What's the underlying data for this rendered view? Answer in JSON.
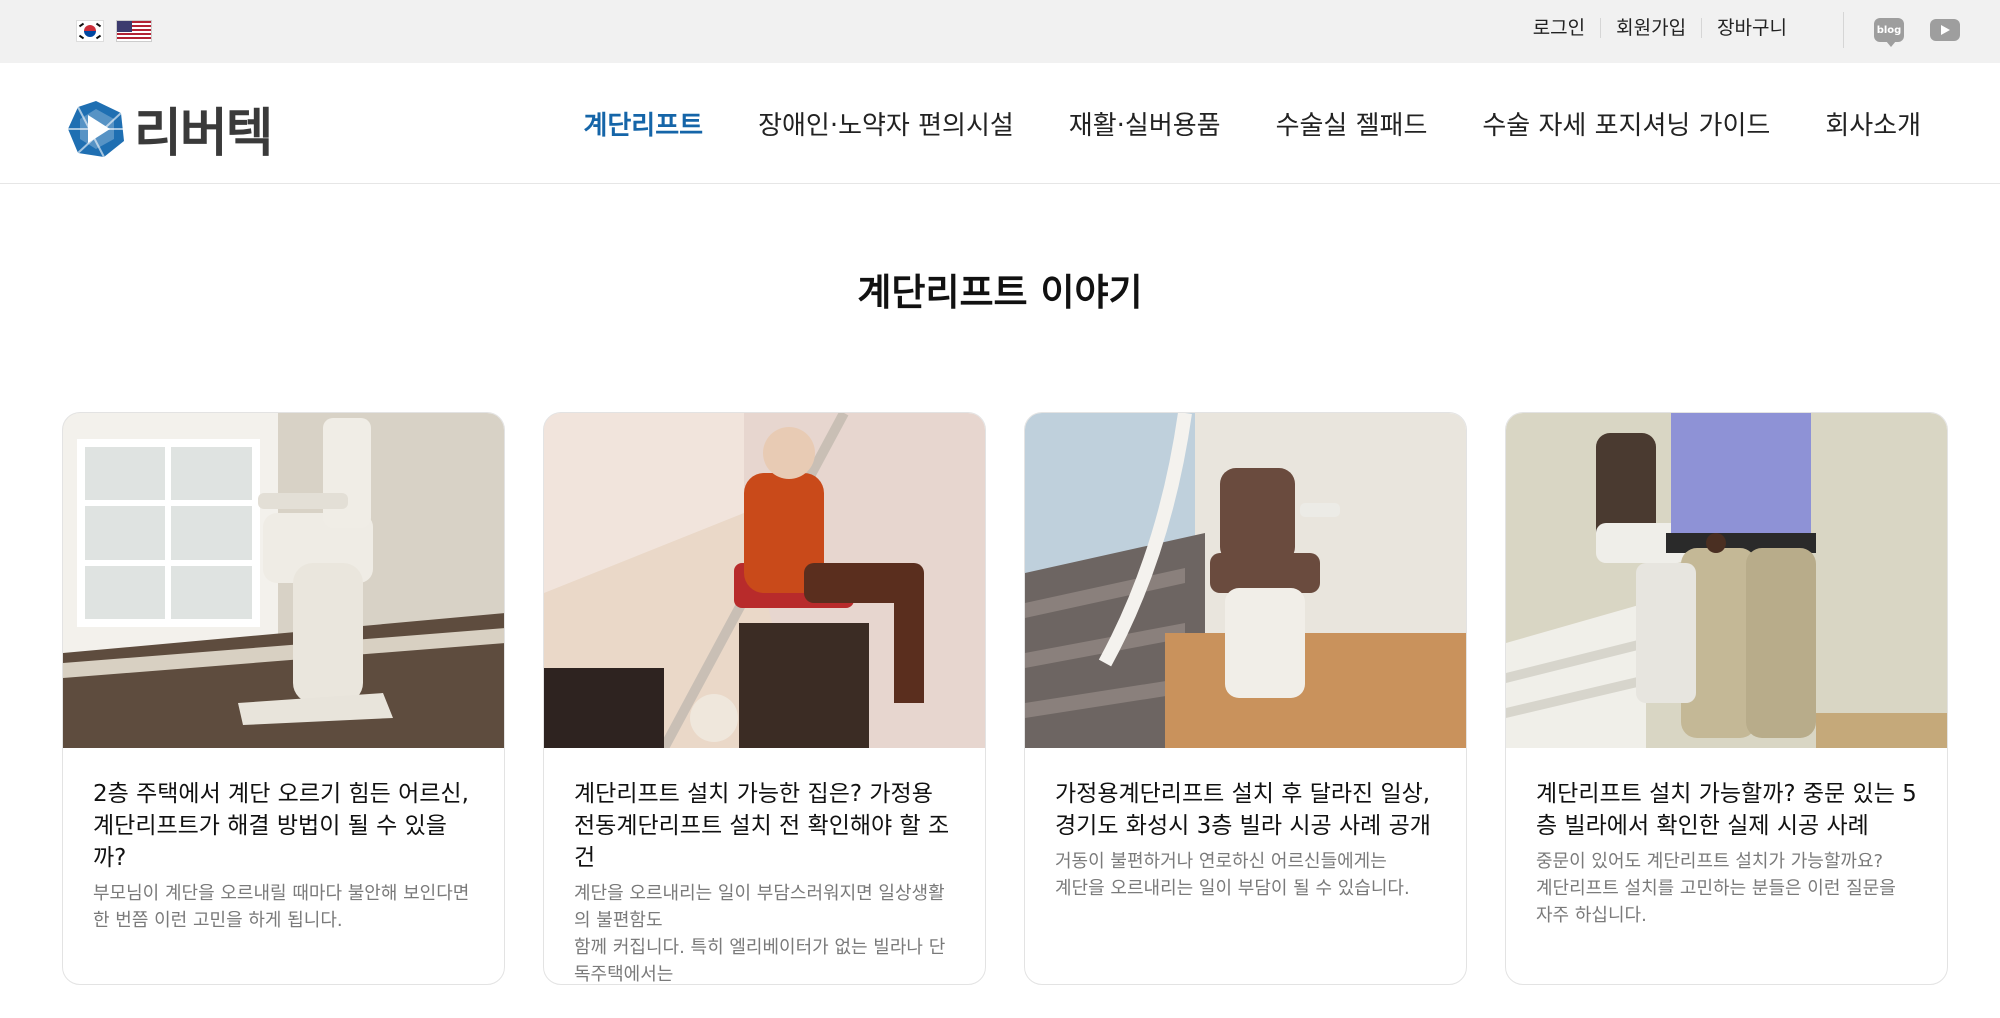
{
  "topbar": {
    "flags": [
      "flag-korea-icon",
      "flag-usa-icon"
    ],
    "links": [
      "로그인",
      "회원가입",
      "장바구니"
    ],
    "social": {
      "blog_label": "blog"
    }
  },
  "header": {
    "logo_text": "리버텍",
    "nav": [
      "계단리프트",
      "장애인‧노약자 편의시설",
      "재활‧실버용품",
      "수술실 젤패드",
      "수술 자세 포지셔닝 가이드",
      "회사소개"
    ],
    "active_index": 0
  },
  "main": {
    "section_title": "계단리프트 이야기",
    "cards": [
      {
        "title": "2층 주택에서 계단 오르기 힘든 어르신, 계단리프트가 해결 방법이 될 수 있을까?",
        "desc": "부모님이 계단을 오르내릴 때마다 불안해 보인다면 한 번쯤 이런 고민을 하게 됩니다."
      },
      {
        "title": "계단리프트 설치 가능한 집은? 가정용 전동계단리프트 설치 전 확인해야 할 조건",
        "desc": "계단을 오르내리는 일이 부담스러워지면 일상생활의 불편함도\n함께 커집니다. 특히 엘리베이터가 없는 빌라나 단독주택에서는"
      },
      {
        "title": "가정용계단리프트 설치 후 달라진 일상, 경기도 화성시 3층 빌라 시공 사례 공개",
        "desc": "거동이 불편하거나 연로하신 어르신들에게는\n계단을 오르내리는 일이 부담이 될 수 있습니다."
      },
      {
        "title": "계단리프트 설치 가능할까? 중문 있는 5층 빌라에서 확인한 실제 시공 사례",
        "desc": "중문이 있어도 계단리프트 설치가 가능할까요?\n계단리프트 설치를 고민하는 분들은 이런 질문을 자주 하십니다."
      }
    ]
  },
  "colors": {
    "accent": "#1565a8",
    "topbar_bg": "#f1f1f1",
    "logo_blue": "#1f6fb2"
  }
}
